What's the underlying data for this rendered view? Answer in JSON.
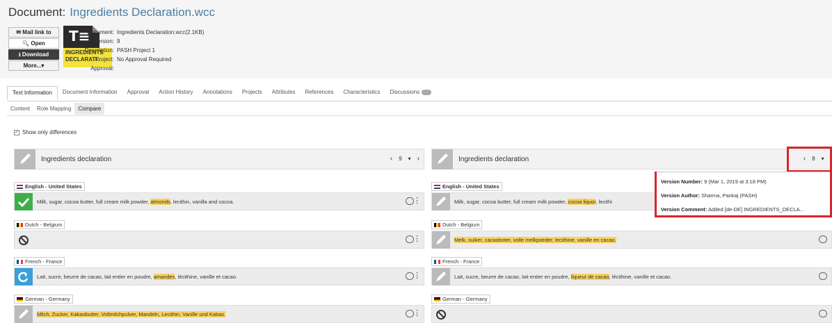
{
  "header": {
    "title_prefix": "Document:",
    "filename": "Ingredients Declaration.wcc",
    "buttons": {
      "mail": "✉ Mail link to",
      "open": "🔍 Open",
      "download": "⭳ Download",
      "more": "More...▾"
    },
    "thumb_text": "INGREDIENTS DECLARATI..",
    "meta": {
      "document_label": "Document:",
      "document_value": "Ingredients Declaration.wcc(2.1KB)",
      "version_label": "Version:",
      "version_value": "9",
      "description_label": "Description:",
      "description_value": "",
      "project_label": "Project:",
      "project_value": "PASH Project 1",
      "approval_label": "Approval:",
      "approval_value": "No Approval Required"
    }
  },
  "tabs": [
    "Text Information",
    "Document Information",
    "Approval",
    "Action History",
    "Annotations",
    "Projects",
    "Attributes",
    "References",
    "Characteristics",
    "Discussions"
  ],
  "subtabs": [
    "Content",
    "Role Mapping",
    "Compare"
  ],
  "show_diff_label": "Show only differences",
  "left_panel": {
    "title": "Ingredients declaration",
    "version": "9",
    "rows": [
      {
        "lang": "English - United States",
        "bold": true,
        "icon": "check-icon",
        "pre": "Milk, sugar, cocoa butter, full cream milk powder, ",
        "hl": "almonds",
        "post": ", lecithin, vanilla and cocoa."
      },
      {
        "lang": "Dutch - Belgium",
        "bold": false,
        "icon": "block-icon",
        "pre": "",
        "hl": "",
        "post": ""
      },
      {
        "lang": "French - France",
        "bold": false,
        "icon": "refresh-icon",
        "pre": "Lait, sucre, beurre de cacao, lait entier en poudre, ",
        "hl": "amandes",
        "post": ", lécithine, vanille et cacao."
      },
      {
        "lang": "German - Germany",
        "bold": false,
        "icon": "pencil-icon",
        "pre": "",
        "hl": "Milch, Zucker, Kakaobutter, Vollmilchpulver, Mandeln, Lecithin, Vanille und Kakao.",
        "post": ""
      }
    ]
  },
  "right_panel": {
    "title": "Ingredients declaration",
    "version": "8",
    "rows": [
      {
        "lang": "English - United States",
        "bold": true,
        "icon": "pencil-icon",
        "pre": "Milk, sugar, cocoa butter, full cream milk powder, ",
        "hl": "cocoa liquor",
        "post": ", lecithi"
      },
      {
        "lang": "Dutch - Belgium",
        "bold": false,
        "icon": "pencil-icon",
        "pre": "",
        "hl": "Melk, suiker, cacaoboter, volle melkpoeder, lecithine, vanille en cacao.",
        "post": ""
      },
      {
        "lang": "French - France",
        "bold": false,
        "icon": "pencil-icon",
        "pre": "Lait, sucre, beurre de cacao, lait entier en poudre, ",
        "hl": "liqueur de cacao",
        "post": ", lécithine, vanille et cacao."
      },
      {
        "lang": "German - Germany",
        "bold": false,
        "icon": "block-icon",
        "pre": "",
        "hl": "",
        "post": ""
      }
    ]
  },
  "tooltip": {
    "number_label": "Version Number:",
    "number_value": "9 (Mar 1, 2019 at 3:18 PM)",
    "author_label": "Version Author:",
    "author_value": "Sharma, Pankaj (PASH)",
    "comment_label": "Version Comment:",
    "comment_value": "Added [de-DE] INGREDIENTS_DECLA..."
  },
  "colors": {
    "accent_blue": "#4a7ea5",
    "highlight": "#f8d25c",
    "check_green": "#3fae49",
    "refresh_blue": "#3a9fd8",
    "red_box": "#d9232e"
  }
}
